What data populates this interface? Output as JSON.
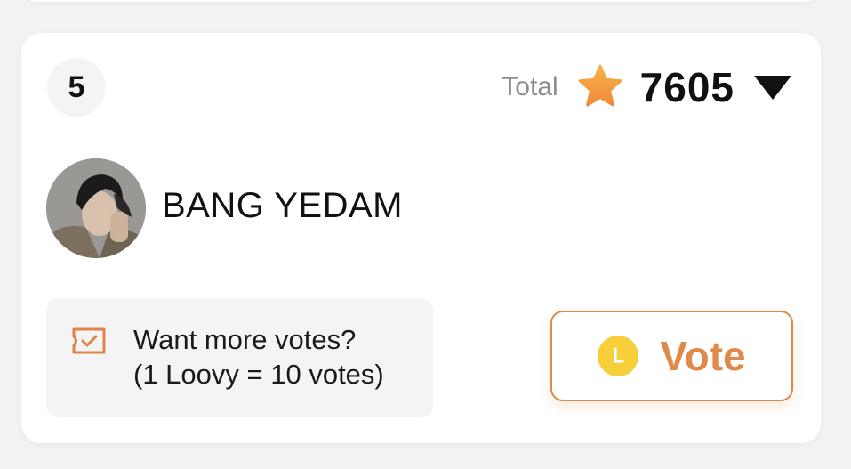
{
  "card": {
    "rank": "5",
    "total_label": "Total",
    "total_value": "7605",
    "artist_name": "BANG YEDAM",
    "info": {
      "line1": "Want more votes?",
      "line2": "(1 Loovy = 10 votes)"
    },
    "vote_label": "Vote"
  },
  "icons": {
    "star": "star-icon",
    "expand": "chevron-down-icon",
    "info": "ticket-check-icon",
    "coin": "loovy-coin-icon"
  },
  "colors": {
    "accent": "#e08a4a",
    "star": "#f39a3d",
    "coin": "#f6cf3a",
    "muted_text": "#8a8d91",
    "panel": "#f4f4f5"
  }
}
